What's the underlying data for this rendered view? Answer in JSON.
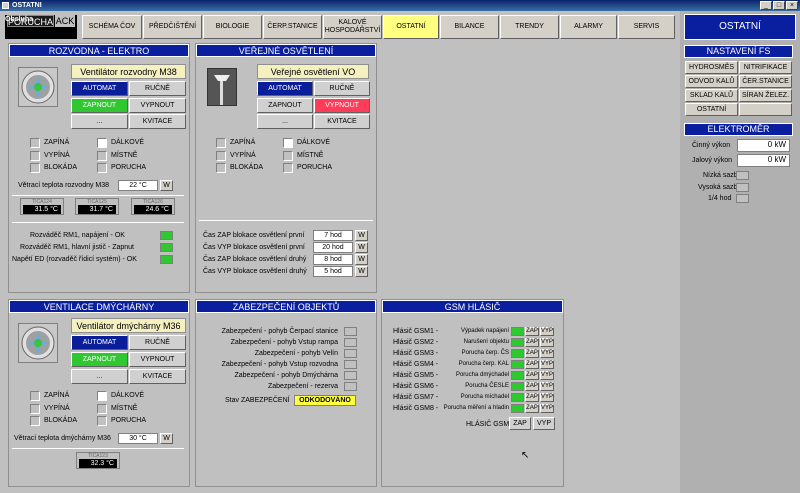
{
  "window": {
    "title": "OSTATNI"
  },
  "status": {
    "label": "Obsluha",
    "poruch": "PORUCHA",
    "ack": "ACK"
  },
  "nav": {
    "tabs": [
      {
        "label": "SCHÉMA ČOV"
      },
      {
        "label": "PŘEDČIŠTĚNÍ"
      },
      {
        "label": "BIOLOGIE"
      },
      {
        "label": "ČERP.STANICE"
      },
      {
        "label": "KALOVÉ HOSPODÁŘSTVÍ"
      },
      {
        "label": "OSTATNÍ"
      },
      {
        "label": "BILANCE"
      },
      {
        "label": "TRENDY"
      },
      {
        "label": "ALARMY"
      },
      {
        "label": "SERVIS"
      }
    ]
  },
  "rozvodna": {
    "title": "ROZVODNA - ELEKTRO",
    "device": "Ventilátor rozvodny M38",
    "automat": "AUTOMAT",
    "rucne": "RUČNĚ",
    "zapnout": "ZAPNOUT",
    "vypnout": "VYPNOUT",
    "dots": "...",
    "kvitace": "KVITACE",
    "chk": [
      "ZAPÍNÁ",
      "VYPÍNÁ",
      "BLOKÁDA",
      "DÁLKOVÉ",
      "MÍSTNĚ",
      "PORUCHA"
    ],
    "temp_label": "Větrací teplota rozvodny M38",
    "temp_value": "22 °C",
    "w": "W",
    "sensors": [
      {
        "tag": "TICA124",
        "value": "31.5 °C"
      },
      {
        "tag": "TICA125",
        "value": "31.7 °C"
      },
      {
        "tag": "TICA126",
        "value": "24.6 °C"
      }
    ],
    "status": [
      "Rozváděč RM1, napájení - OK",
      "Rozváděč RM1, hlavní jistič - Zapnut",
      "Napětí ED (rozvaděč řídicí systém) - OK"
    ]
  },
  "osvetleni": {
    "title": "VEŘEJNÉ OSVĚTLENÍ",
    "device": "Veřejné osvětlení VO",
    "automat": "AUTOMAT",
    "rucne": "RUČNĚ",
    "zapnout": "ZAPNOUT",
    "vypnout": "VYPNOUT",
    "dots": "...",
    "kvitace": "KVITACE",
    "chk": [
      "ZAPÍNÁ",
      "VYPÍNÁ",
      "BLOKÁDA",
      "DÁLKOVÉ",
      "MÍSTNĚ",
      "PORUCHA"
    ],
    "blok": [
      {
        "label": "Čas ZAP blokace osvětlení první",
        "value": "7 hod"
      },
      {
        "label": "Čas VYP blokace osvětlení první",
        "value": "20 hod"
      },
      {
        "label": "Čas ZAP blokace osvětlení druhý",
        "value": "8 hod"
      },
      {
        "label": "Čas VYP blokace osvětlení druhý",
        "value": "5 hod"
      }
    ],
    "w": "W"
  },
  "ventilace": {
    "title": "VENTILACE DMÝCHÁRNY",
    "device": "Ventilátor dmýchárny M36",
    "automat": "AUTOMAT",
    "rucne": "RUČNĚ",
    "zapnout": "ZAPNOUT",
    "vypnout": "VYPNOUT",
    "dots": "...",
    "kvitace": "KVITACE",
    "chk": [
      "ZAPÍNÁ",
      "VYPÍNÁ",
      "BLOKÁDA",
      "DÁLKOVÉ",
      "MÍSTNĚ",
      "PORUCHA"
    ],
    "temp_label": "Větrací teplota dmýchárny M36",
    "temp_value": "30 °C",
    "w": "W",
    "sensor": {
      "tag": "TICA123",
      "value": "32.3 °C"
    }
  },
  "zabezpeceni": {
    "title": "ZABEZPEČENÍ OBJEKTŮ",
    "items": [
      "Zabezpečení - pohyb Čerpací stanice",
      "Zabezpečení - pohyb Vstup rampa",
      "Zabezpečení - pohyb Velín",
      "Zabezpečení - pohyb Vstup rozvodna",
      "Zabezpečení - pohyb Dmýchárna",
      "Zabezpečení - rezerva"
    ],
    "stav_label": "Stav ZABEZPEČENÍ",
    "stav_value": "ODKODOVÁNO"
  },
  "gsm": {
    "title": "GSM HLÁSIČ",
    "rows": [
      {
        "name": "Hlásič GSM1 -",
        "desc": "Výpadek napájení"
      },
      {
        "name": "Hlásič GSM2 -",
        "desc": "Narušení objektu"
      },
      {
        "name": "Hlásič GSM3 -",
        "desc": "Porucha čerp. ČS"
      },
      {
        "name": "Hlásič GSM4 -",
        "desc": "Porucha čerp. KAL"
      },
      {
        "name": "Hlásič GSM5 -",
        "desc": "Porucha dmýchadel"
      },
      {
        "name": "Hlásič GSM6 -",
        "desc": "Porucha ČESLE"
      },
      {
        "name": "Hlásič GSM7 -",
        "desc": "Porucha míchadel"
      },
      {
        "name": "Hlásič GSM8 -",
        "desc": "Porucha měření a hladin"
      }
    ],
    "zap": "ZAP",
    "vyp": "VYP",
    "footer_label": "HLÁSIČ GSM"
  },
  "sidebar": {
    "title": "OSTATNÍ",
    "nastaveni": "NASTAVENÍ FS",
    "fs": [
      "HYDROSMĚS",
      "NITRIFIKACE",
      "ODVOD KALŮ",
      "ČER.STANICE",
      "SKLAD KALŮ",
      "SÍRAN ŽELEZ.",
      "OSTATNÍ",
      ""
    ],
    "elektromer": "ELEKTROMĚR",
    "cinny_label": "Činný výkon",
    "cinny_value": "0 kW",
    "jalovy_label": "Jalový výkon",
    "jalovy_value": "0 kW",
    "sazby": [
      "Nízká sazba",
      "Vysoká sazba",
      "1/4 hod"
    ]
  },
  "colors": {
    "header": "#0a1ea0",
    "active_tab": "#ffff80",
    "green": "#30c830",
    "red": "#ff3c5a"
  }
}
